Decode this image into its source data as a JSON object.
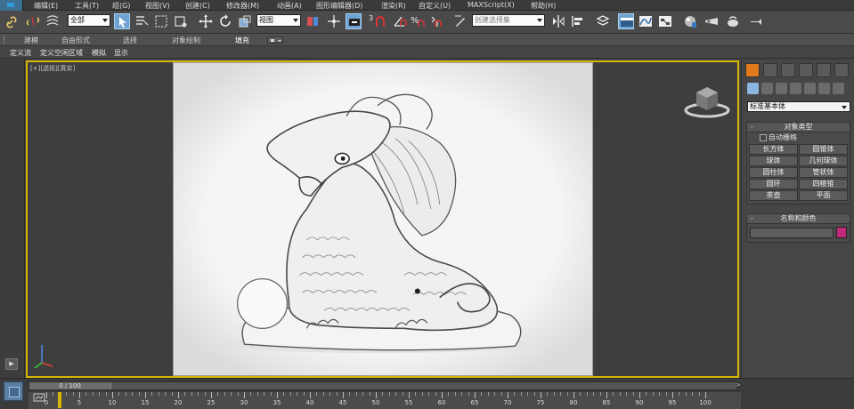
{
  "menu": [
    "编辑(E)",
    "工具(T)",
    "组(G)",
    "视图(V)",
    "创建(C)",
    "修改器(M)",
    "动画(A)",
    "图形编辑器(D)",
    "渲染(R)",
    "自定义(U)",
    "MAXScript(X)",
    "帮助(H)"
  ],
  "toolbar": {
    "selection_filter": "全部",
    "ref_coord": "视图",
    "snap_value": "3",
    "named_selection": "创建选择集"
  },
  "ribbon": {
    "tabs": [
      "建模",
      "自由形式",
      "选择",
      "对象绘制",
      "填充"
    ],
    "active_tab": "填充",
    "subtabs": [
      "定义流",
      "定义空闲区域",
      "模拟",
      "显示"
    ]
  },
  "viewport": {
    "label": "[+][透视][真实]"
  },
  "command_panel": {
    "category": "标准基本体",
    "object_type": {
      "title": "对象类型",
      "autogrid": "自动栅格",
      "buttons": [
        "长方体",
        "圆锥体",
        "球体",
        "几何球体",
        "圆柱体",
        "管状体",
        "圆环",
        "四棱锥",
        "茶壶",
        "平面"
      ]
    },
    "name_color": {
      "title": "名称和颜色",
      "swatch_color": "#c0287a"
    }
  },
  "timeline": {
    "frame_display": "0 / 100",
    "ticks": [
      0,
      5,
      10,
      15,
      20,
      25,
      30,
      35,
      40,
      45,
      50,
      55,
      60,
      65,
      70,
      75,
      80,
      85,
      90,
      95,
      100
    ]
  }
}
